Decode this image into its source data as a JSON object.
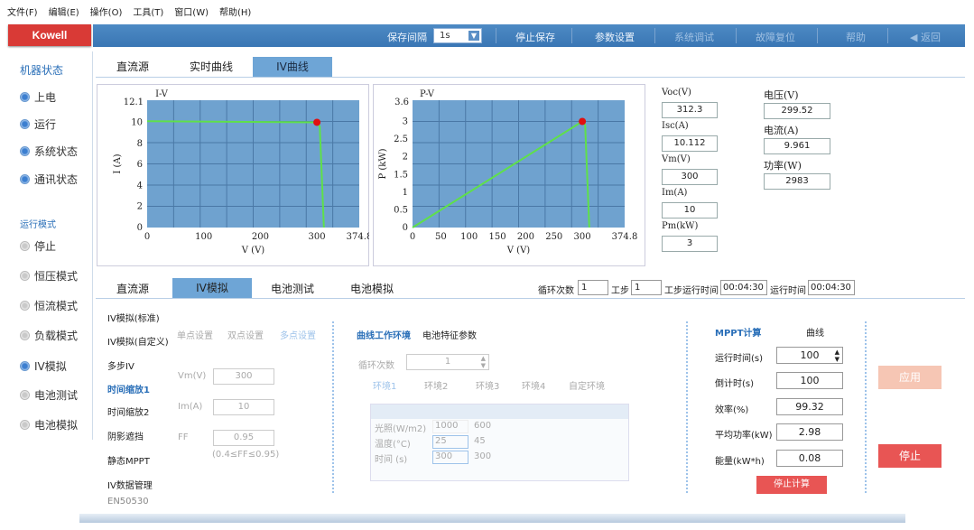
{
  "menu": [
    "文件(F)",
    "编辑(E)",
    "操作(O)",
    "工具(T)",
    "窗口(W)",
    "帮助(H)"
  ],
  "logo": "Kowell",
  "toolbar": {
    "interval_label": "保存间隔",
    "interval_value": "1s",
    "stop_save": "停止保存",
    "param_settings": "参数设置",
    "system_debug": "系统调试",
    "fault_reset": "故障复位",
    "help": "帮助",
    "back": "◀ 返回"
  },
  "sidebar": {
    "machine_status_title": "机器状态",
    "status_items": [
      "上电",
      "运行",
      "系统状态",
      "通讯状态"
    ],
    "run_mode_title": "运行模式",
    "mode_items": [
      "停止",
      "恒压模式",
      "恒流模式",
      "负载模式",
      "IV模拟",
      "电池测试",
      "电池模拟"
    ]
  },
  "top_tabs": [
    "直流源",
    "实时曲线",
    "IV曲线"
  ],
  "iv_chart": {
    "title": "I-V",
    "ylabel": "I (A)",
    "xlabel": "V (V)",
    "y_top_label": "12.1",
    "yticks": [
      "10",
      "8",
      "6",
      "4",
      "2",
      "0"
    ],
    "xticks": [
      "0",
      "100",
      "200",
      "300",
      "374.8"
    ]
  },
  "pv_chart": {
    "title": "P-V",
    "ylabel": "P (kW)",
    "xlabel": "V (V)",
    "y_top_label": "3.6",
    "yticks": [
      "3",
      "2.5",
      "2",
      "1.5",
      "1",
      "0.5",
      "0"
    ],
    "xticks": [
      "0",
      "50",
      "100",
      "150",
      "200",
      "250",
      "300",
      "374.8"
    ]
  },
  "chart_data": [
    {
      "type": "line",
      "title": "I-V",
      "xlabel": "V (V)",
      "ylabel": "I (A)",
      "xlim": [
        0,
        374.8
      ],
      "ylim": [
        0,
        12.1
      ],
      "x": [
        0,
        300,
        305,
        312.3
      ],
      "y": [
        10.1,
        10.0,
        9.6,
        0
      ],
      "marker": {
        "x": 300,
        "y": 10
      }
    },
    {
      "type": "line",
      "title": "P-V",
      "xlabel": "V (V)",
      "ylabel": "P (kW)",
      "xlim": [
        0,
        374.8
      ],
      "ylim": [
        0,
        3.6
      ],
      "x": [
        0,
        300,
        305,
        312.3
      ],
      "y": [
        0,
        3.0,
        2.9,
        0
      ],
      "marker": {
        "x": 300,
        "y": 3.0
      }
    }
  ],
  "readouts_left": [
    {
      "label": "Voc(V)",
      "value": "312.3"
    },
    {
      "label": "Isc(A)",
      "value": "10.112"
    },
    {
      "label": "Vm(V)",
      "value": "300"
    },
    {
      "label": "Im(A)",
      "value": "10"
    },
    {
      "label": "Pm(kW)",
      "value": "3"
    }
  ],
  "readouts_right": [
    {
      "label": "电压(V)",
      "value": "299.52"
    },
    {
      "label": "电流(A)",
      "value": "9.961"
    },
    {
      "label": "功率(W)",
      "value": "2983"
    }
  ],
  "bottom_tabs": [
    "直流源",
    "IV模拟",
    "电池测试",
    "电池模拟"
  ],
  "cycle": {
    "cycle_count_label": "循环次数",
    "cycle_count": "1",
    "step_label": "工步",
    "step": "1",
    "step_time_label": "工步运行时间",
    "step_time": "00:04:30",
    "run_time_label": "运行时间",
    "run_time": "00:04:30"
  },
  "iv_menu": [
    "IV模拟(标准)",
    "IV模拟(自定义)",
    "多步IV",
    "时间缩放1",
    "时间缩放2",
    "阴影遮挡",
    "静态MPPT",
    "IV数据管理",
    "EN50530"
  ],
  "point_settings": [
    "单点设置",
    "双点设置",
    "多点设置"
  ],
  "params": [
    {
      "label": "Vm(V)",
      "value": "300"
    },
    {
      "label": "Im(A)",
      "value": "10"
    },
    {
      "label": "FF",
      "value": "0.95"
    }
  ],
  "ff_hint": "(0.4≤FF≤0.95)",
  "curve_env": {
    "tab_active": "曲线工作环境",
    "tab_other": "电池特征参数",
    "cycle_label": "循环次数",
    "cycle_value": "1",
    "env_tabs": [
      "环境1",
      "环境2",
      "环境3",
      "环境4",
      "自定环境"
    ],
    "table_headers": [
      "",
      "",
      "",
      "",
      "",
      "",
      ""
    ],
    "rows": [
      {
        "name": "光照(W/m2)",
        "v1": "1000",
        "v2": "600"
      },
      {
        "name": "温度(°C)",
        "v1": "25",
        "v2": "45"
      },
      {
        "name": "时间 (s)",
        "v1": "300",
        "v2": "300"
      }
    ]
  },
  "mppt": {
    "title": "MPPT计算",
    "curve": "曲线",
    "rows": [
      {
        "label": "运行时间(s)",
        "value": "100"
      },
      {
        "label": "倒计时(s)",
        "value": "100"
      },
      {
        "label": "效率(%)",
        "value": "99.32"
      },
      {
        "label": "平均功率(kW)",
        "value": "2.98"
      },
      {
        "label": "能量(kW*h)",
        "value": "0.08"
      }
    ],
    "stop_calc": "停止计算"
  },
  "apply_button": "应用",
  "stop_button": "停止",
  "colors": {
    "toolbar": "#3f7cb9",
    "plot_bg": "#6fa2cf",
    "curve": "#5fe04a",
    "marker": "#e01010",
    "red_btn": "#e85554"
  }
}
